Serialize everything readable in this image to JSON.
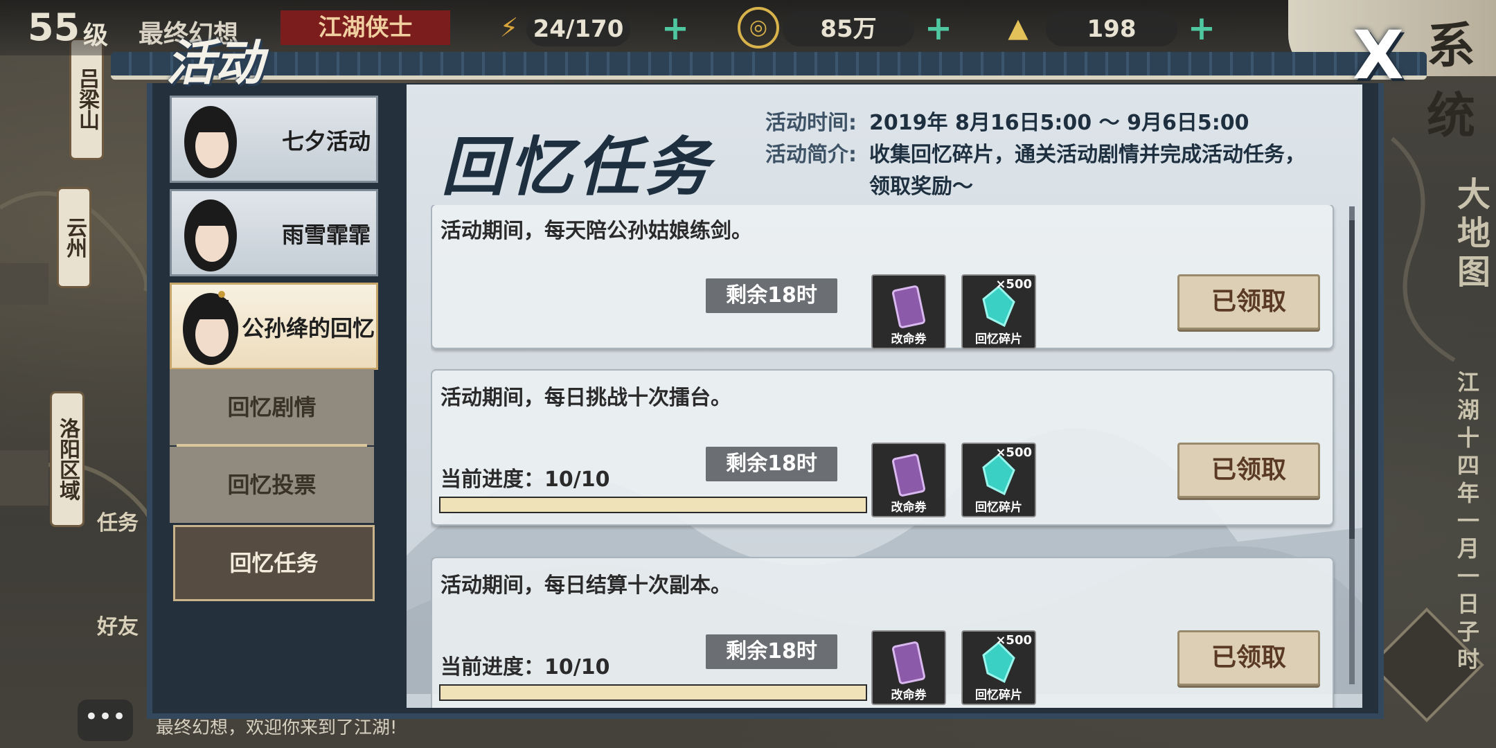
{
  "topbar": {
    "level_num": "55",
    "level_unit": "级",
    "player_name": "最终幻想",
    "rank_tag": "江湖侠士",
    "stamina": "24/170",
    "coins": "85万",
    "ingots": "198",
    "plus_symbol": "+",
    "system_label": "系统"
  },
  "panel": {
    "title": "活动",
    "close_symbol": "X"
  },
  "sidebar": {
    "characters": [
      {
        "name": "七夕活动"
      },
      {
        "name": "雨雪霏霏"
      },
      {
        "name": "公孙绛的回忆"
      }
    ],
    "sub_menu": [
      {
        "label": "回忆剧情"
      },
      {
        "label": "回忆投票"
      },
      {
        "label": "回忆任务"
      }
    ]
  },
  "content": {
    "title": "回忆任务",
    "time_label": "活动时间:",
    "time_value": "2019年 8月16日5:00 ～ 9月6日5:00",
    "desc_label": "活动简介:",
    "desc_line1": "收集回忆碎片，通关活动剧情并完成活动任务，",
    "desc_line2": "领取奖励～"
  },
  "tasks": [
    {
      "desc": "活动期间，每天陪公孙姑娘练剑。",
      "progress_label": "",
      "time_left": "剩余18时",
      "reward1_label": "改命券",
      "reward2_label": "回忆碎片",
      "reward2_count": "×500",
      "claim_label": "已领取"
    },
    {
      "desc": "活动期间，每日挑战十次擂台。",
      "progress_label": "当前进度：10/10",
      "progress": 1.0,
      "time_left": "剩余18时",
      "reward1_label": "改命券",
      "reward2_label": "回忆碎片",
      "reward2_count": "×500",
      "claim_label": "已领取"
    },
    {
      "desc": "活动期间，每日结算十次副本。",
      "progress_label": "当前进度：10/10",
      "progress": 1.0,
      "time_left": "剩余18时",
      "reward1_label": "改命券",
      "reward2_label": "回忆碎片",
      "reward2_count": "×500",
      "claim_label": "已领取"
    }
  ],
  "map": {
    "label_lvliang": "吕梁山",
    "label_yunzhou": "云州",
    "label_luoyang": "洛阳区域",
    "label_task": "任务",
    "label_friend": "好友",
    "right_big_map": "大地图",
    "right_date": "江湖十四年一月一日子时",
    "ticker": "最终幻想，欢迎你来到了江湖!",
    "chat_icon": "•••"
  },
  "colors": {
    "accent_blue": "#1e3040",
    "rank_red": "#7c1d1d",
    "plus_green": "#4fc7a0",
    "claim_bg": "#dccfb5"
  }
}
